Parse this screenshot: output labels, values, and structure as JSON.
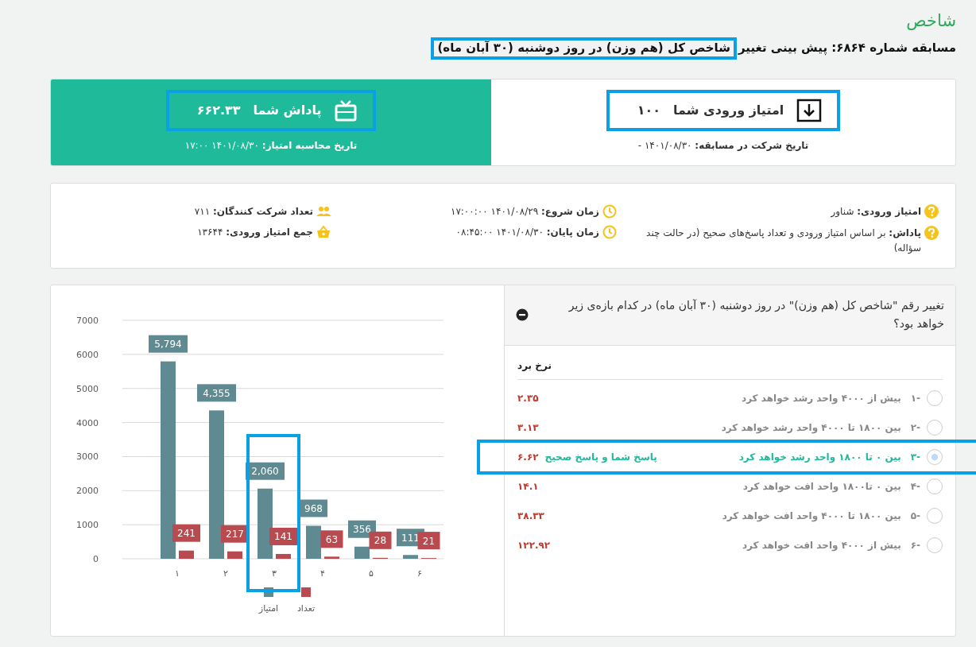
{
  "page_title": "شاخص",
  "subtitle": {
    "prefix": "مسابقه شماره ۶۸۶۴: پیش بینی تغییر",
    "rest": "شاخص کل (هم وزن) در روز دوشنبه (۳۰ آبان ماه)",
    "highlighted": true
  },
  "entry_score": {
    "label": "امتیاز ورودی شما",
    "value": "۱۰۰",
    "highlighted": true,
    "date_label": "تاریخ شرکت در مسابقه:",
    "date": "۱۴۰۱/۰۸/۳۰ -"
  },
  "reward": {
    "label": "پاداش شما",
    "value": "۶۶۲.۳۳",
    "highlighted": true,
    "date_label": "تاریخ محاسبه امتیاز:",
    "date": "۱۴۰۱/۰۸/۳۰ ۱۷:۰۰"
  },
  "info": [
    {
      "kind": "help",
      "text": "**امتیاز ورودی:** شناور"
    },
    {
      "kind": "help",
      "text": "**پاداش:** بر اساس امتیاز ورودی و تعداد پاسخ‌های صحیح (در حالت چند سؤاله)"
    },
    {
      "kind": "clock",
      "text": "**زمان شروع:** ۱۴۰۱/۰۸/۲۹ ۱۷:۰۰:۰۰"
    },
    {
      "kind": "clock",
      "text": "**زمان پایان:** ۱۴۰۱/۰۸/۳۰ ۰۸:۴۵:۰۰"
    },
    {
      "kind": "people",
      "text": "**تعداد شرکت کنندگان:** ۷۱۱"
    },
    {
      "kind": "basket",
      "text": "**جمع امتیاز ورودی:** ۱۳۶۴۴"
    }
  ],
  "question": {
    "text": "تغییر رقم \"شاخص کل (هم وزن)\" در روز دوشنبه (۳۰ آبان ماه) در کدام بازه‌ی زیر خواهد بود؟",
    "odds_header": "نرخ برد",
    "options": [
      {
        "number": "-۱",
        "text": "بیش از ۴۰۰۰ واحد رشد خواهد کرد",
        "odds": "۲.۳۵",
        "selected": false,
        "correct": false,
        "highlighted": false
      },
      {
        "number": "-۲",
        "text": "بین ۱۸۰۰ تا ۴۰۰۰ واحد رشد خواهد کرد",
        "odds": "۳.۱۳",
        "selected": false,
        "correct": false,
        "highlighted": false
      },
      {
        "number": "-۳",
        "text": "بین ۰ تا ۱۸۰۰ واحد رشد خواهد کرد",
        "note": "پاسخ شما و پاسخ صحیح",
        "odds": "۶.۶۲",
        "selected": true,
        "correct": true,
        "highlighted": true
      },
      {
        "number": "-۴",
        "text": "بین ۰ تا۱۸۰۰ واحد افت خواهد کرد",
        "odds": "۱۴.۱",
        "selected": false,
        "correct": false,
        "highlighted": false
      },
      {
        "number": "-۵",
        "text": "بین ۱۸۰۰ تا ۴۰۰۰ واحد افت خواهد کرد",
        "odds": "۳۸.۳۳",
        "selected": false,
        "correct": false,
        "highlighted": false
      },
      {
        "number": "-۶",
        "text": "بیش از ۴۰۰۰ واحد افت خواهد کرد",
        "odds": "۱۲۲.۹۲",
        "selected": false,
        "correct": false,
        "highlighted": false
      }
    ]
  },
  "chart_data": {
    "type": "bar",
    "categories": [
      "۱",
      "۲",
      "۳",
      "۴",
      "۵",
      "۶"
    ],
    "series": [
      {
        "name": "امتیاز",
        "color": "#5f8a92",
        "values": [
          5794,
          4355,
          2060,
          968,
          356,
          111
        ]
      },
      {
        "name": "تعداد",
        "color": "#b94a50",
        "values": [
          241,
          217,
          141,
          63,
          28,
          21
        ]
      }
    ],
    "ylim": [
      0,
      7000
    ],
    "yticks": [
      0,
      1000,
      2000,
      3000,
      4000,
      5000,
      6000,
      7000
    ],
    "value_labels": [
      [
        "5,794",
        "4,355",
        "2,060",
        "968",
        "356",
        "111"
      ],
      [
        "241",
        "217",
        "141",
        "63",
        "28",
        "21"
      ]
    ],
    "grid": true,
    "legend": true
  },
  "chart_frame": {
    "highlighted_categories": [
      false,
      false,
      true,
      false,
      false,
      false
    ]
  }
}
